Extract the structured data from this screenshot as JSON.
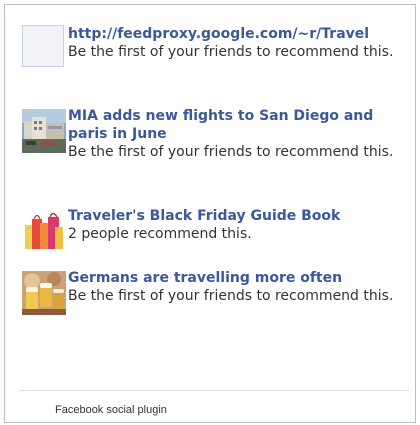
{
  "items": [
    {
      "title": "http://feedproxy.google.com/~r/Travel",
      "subtitle": "Be the first of your friends to recommend this.",
      "thumbnail": "blank-thumbnail"
    },
    {
      "title": "MIA adds new flights to San Diego and paris in June",
      "subtitle": "Be the first of your friends to recommend this.",
      "thumbnail": "airport-building-photo"
    },
    {
      "title": "Traveler's Black Friday Guide Book",
      "subtitle": "2 people recommend this.",
      "thumbnail": "shopping-bags-photo"
    },
    {
      "title": "Germans are travelling more often",
      "subtitle": "Be the first of your friends to recommend this.",
      "thumbnail": "beer-celebration-photo"
    }
  ],
  "footer": {
    "label": "Facebook social plugin"
  },
  "colors": {
    "link": "#3b5998",
    "text": "#333333",
    "border": "#b8bec9"
  }
}
